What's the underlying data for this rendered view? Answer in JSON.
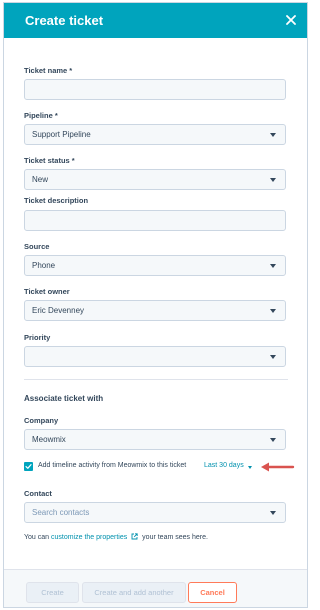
{
  "header": {
    "title": "Create ticket",
    "close_icon": "close-icon"
  },
  "fields": {
    "ticket_name": {
      "label": "Ticket name *",
      "value": ""
    },
    "pipeline": {
      "label": "Pipeline *",
      "value": "Support Pipeline"
    },
    "ticket_status": {
      "label": "Ticket status *",
      "value": "New"
    },
    "ticket_description": {
      "label": "Ticket description",
      "value": ""
    },
    "source": {
      "label": "Source",
      "value": "Phone"
    },
    "ticket_owner": {
      "label": "Ticket owner",
      "value": "Eric Devenney"
    },
    "priority": {
      "label": "Priority",
      "value": ""
    }
  },
  "associate": {
    "title": "Associate ticket with",
    "company": {
      "label": "Company",
      "value": "Meowmix"
    },
    "timeline_checkbox": {
      "checked": true,
      "text": "Add timeline activity from Meowmix to this ticket",
      "range": "Last 30 days"
    },
    "contact": {
      "label": "Contact",
      "placeholder": "Search contacts"
    },
    "helper": {
      "prefix": "You can",
      "link": "customize the properties",
      "suffix": "your team sees here."
    }
  },
  "footer": {
    "create_label": "Create",
    "create_another_label": "Create and add another",
    "cancel_label": "Cancel"
  },
  "colors": {
    "header_bg": "#00a4bd",
    "link": "#0091ae",
    "cancel": "#ff7a59",
    "annotation_arrow": "#d9534f"
  }
}
